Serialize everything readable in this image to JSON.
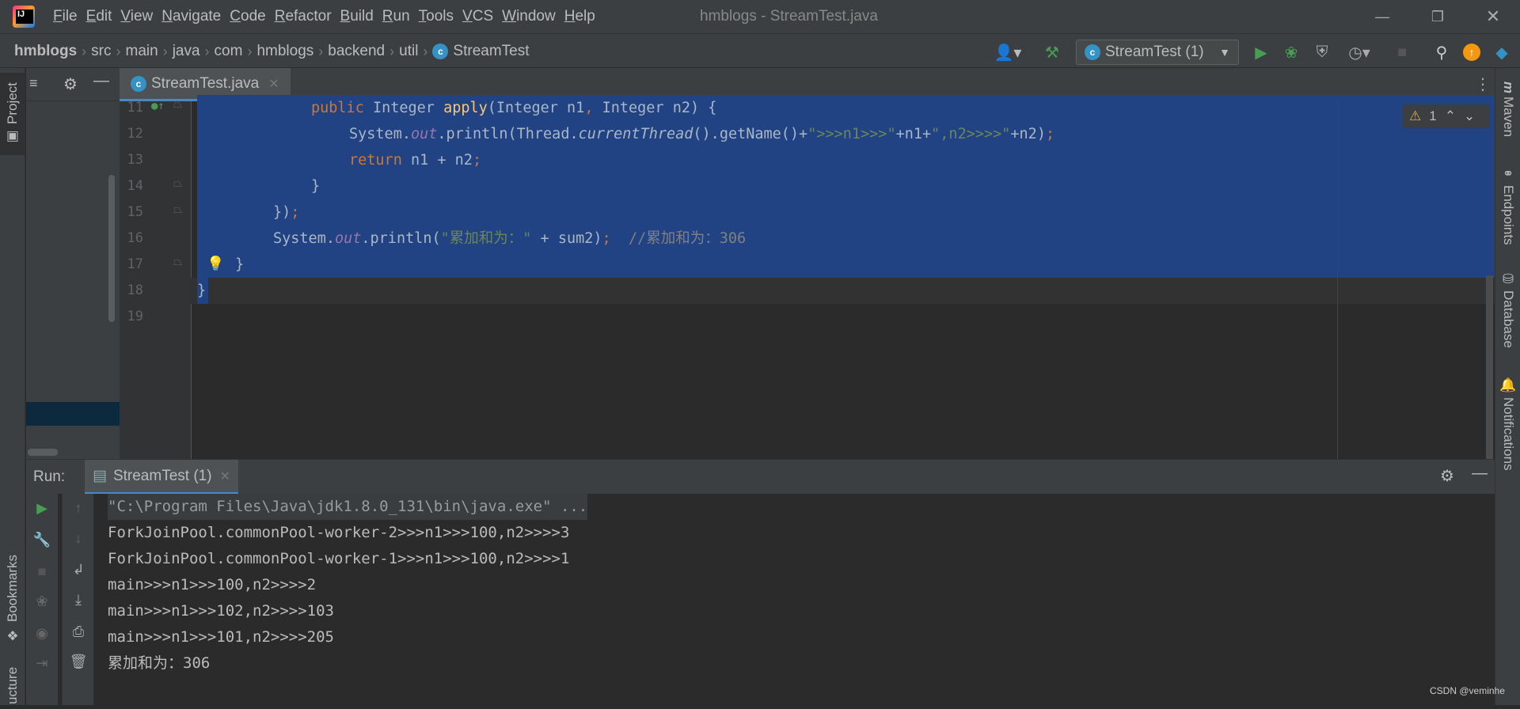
{
  "app": {
    "window_title": "hmblogs - StreamTest.java",
    "logo": "intellij-logo"
  },
  "menu": [
    "File",
    "Edit",
    "View",
    "Navigate",
    "Code",
    "Refactor",
    "Build",
    "Run",
    "Tools",
    "VCS",
    "Window",
    "Help"
  ],
  "menu_mnemonics": [
    "F",
    "E",
    "V",
    "N",
    "C",
    "R",
    "B",
    "R",
    "T",
    "V",
    "W",
    "H"
  ],
  "breadcrumb": [
    "hmblogs",
    "src",
    "main",
    "java",
    "com",
    "hmblogs",
    "backend",
    "util",
    "StreamTest"
  ],
  "run_config": {
    "label": "StreamTest (1)"
  },
  "editor_tab": {
    "label": "StreamTest.java"
  },
  "inspections": {
    "warning_count": "1"
  },
  "left_tabs": {
    "project": "Project",
    "bookmarks": "Bookmarks",
    "structure": "ucture"
  },
  "right_tabs": [
    "Maven",
    "Endpoints",
    "Database",
    "Notifications"
  ],
  "code_lines": [
    {
      "n": "11",
      "text": "public Integer apply(Integer n1, Integer n2) {"
    },
    {
      "n": "12",
      "text": "System.out.println(Thread.currentThread().getName()+\">>>n1>>>\"+n1+\",n2>>>>\"+n2);"
    },
    {
      "n": "13",
      "text": "return n1 + n2;"
    },
    {
      "n": "14",
      "text": "}"
    },
    {
      "n": "15",
      "text": "});"
    },
    {
      "n": "16",
      "text": "System.out.println(\"累加和为：\" + sum2);  //累加和为：306"
    },
    {
      "n": "17",
      "text": "}"
    },
    {
      "n": "18",
      "text": "}"
    },
    {
      "n": "19",
      "text": ""
    }
  ],
  "run_panel": {
    "label": "Run:",
    "tab": "StreamTest (1)"
  },
  "console_lines": [
    "\"C:\\Program Files\\Java\\jdk1.8.0_131\\bin\\java.exe\" ...",
    "ForkJoinPool.commonPool-worker-2>>>n1>>>100,n2>>>>3",
    "ForkJoinPool.commonPool-worker-1>>>n1>>>100,n2>>>>1",
    "main>>>n1>>>100,n2>>>>2",
    "main>>>n1>>>102,n2>>>>103",
    "main>>>n1>>>101,n2>>>>205",
    "累加和为：306"
  ],
  "watermark": "CSDN @veminhe",
  "colors": {
    "selection": "#214283",
    "accent": "#4a88c7",
    "run_green": "#499c54",
    "keyword": "#cc7832",
    "string": "#6a8759"
  }
}
